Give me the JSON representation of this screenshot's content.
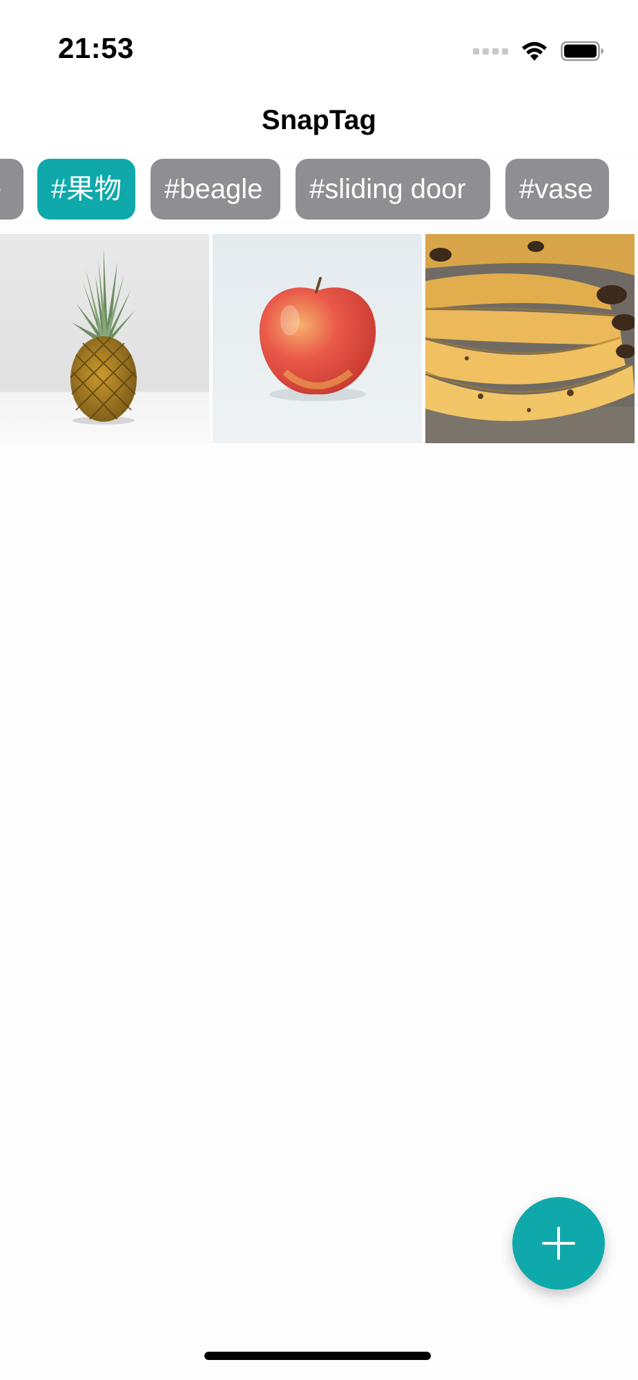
{
  "status_bar": {
    "time": "21:53",
    "icons": [
      "signal-icon",
      "wifi-icon",
      "battery-icon"
    ]
  },
  "nav": {
    "title": "SnapTag"
  },
  "tags": {
    "items": [
      {
        "label": "e",
        "selected": false
      },
      {
        "label": "#果物",
        "selected": true
      },
      {
        "label": "#beagle",
        "selected": false
      },
      {
        "label": "#sliding door",
        "selected": false
      },
      {
        "label": "#vase",
        "selected": false
      }
    ],
    "selected_color": "#0fa9ab",
    "default_color": "#8e8e93"
  },
  "photos": [
    {
      "subject": "pineapple"
    },
    {
      "subject": "apple"
    },
    {
      "subject": "bananas"
    }
  ],
  "fab": {
    "icon": "plus-icon",
    "color": "#0fa9ab"
  }
}
